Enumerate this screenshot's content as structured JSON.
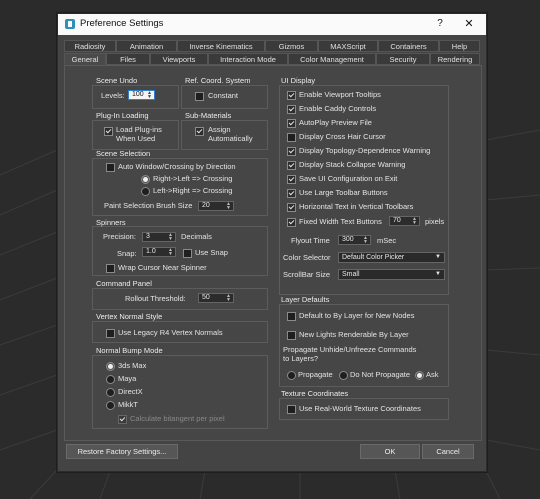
{
  "window": {
    "title": "Preference Settings",
    "help": "?",
    "close": "✕"
  },
  "tabs_row1": [
    "Radiosity",
    "Animation",
    "Inverse Kinematics",
    "Gizmos",
    "MAXScript",
    "Containers",
    "Help"
  ],
  "tabs_row2": [
    "General",
    "Files",
    "Viewports",
    "Interaction Mode",
    "Color Management",
    "Security",
    "Rendering"
  ],
  "active_tab": "General",
  "scene_undo": {
    "title": "Scene Undo",
    "levels_label": "Levels:",
    "levels_value": "100"
  },
  "ref_coord": {
    "title": "Ref. Coord. System",
    "constant_label": "Constant",
    "constant_checked": false
  },
  "plugin_loading": {
    "title": "Plug-In Loading",
    "load_label_1": "Load Plug-ins",
    "load_label_2": "When Used",
    "load_checked": true
  },
  "sub_materials": {
    "title": "Sub-Materials",
    "assign_label_1": "Assign",
    "assign_label_2": "Automatically",
    "assign_checked": true
  },
  "scene_selection": {
    "title": "Scene Selection",
    "auto_window_label": "Auto Window/Crossing by Direction",
    "auto_window_checked": false,
    "right_left_label": "Right->Left => Crossing",
    "right_left_selected": true,
    "left_right_label": "Left->Right => Crossing",
    "left_right_selected": false,
    "brush_size_label": "Paint Selection Brush Size",
    "brush_size_value": "20"
  },
  "spinners": {
    "title": "Spinners",
    "precision_label": "Precision:",
    "precision_value": "3",
    "decimals_label": "Decimals",
    "snap_label": "Snap:",
    "snap_value": "1.0",
    "use_snap_label": "Use Snap",
    "use_snap_checked": false,
    "wrap_label": "Wrap Cursor Near Spinner",
    "wrap_checked": false
  },
  "command_panel": {
    "title": "Command Panel",
    "rollout_label": "Rollout Threshold:",
    "rollout_value": "50"
  },
  "vertex_normal": {
    "title": "Vertex Normal Style",
    "legacy_label": "Use Legacy R4 Vertex Normals",
    "legacy_checked": false
  },
  "normal_bump": {
    "title": "Normal Bump Mode",
    "options": [
      "3ds Max",
      "Maya",
      "DirectX",
      "MikkT"
    ],
    "selected": "3ds Max",
    "bitangent_label": "Calculate bitangent per pixel",
    "bitangent_checked": true
  },
  "ui_display": {
    "title": "UI Display",
    "items": [
      {
        "label": "Enable Viewport Tooltips",
        "checked": true
      },
      {
        "label": "Enable Caddy Controls",
        "checked": true
      },
      {
        "label": "AutoPlay Preview File",
        "checked": true
      },
      {
        "label": "Display Cross Hair Cursor",
        "checked": false
      },
      {
        "label": "Display Topology-Dependence Warning",
        "checked": true
      },
      {
        "label": "Display Stack Collapse Warning",
        "checked": true
      },
      {
        "label": "Save UI Configuration on Exit",
        "checked": true
      },
      {
        "label": "Use Large Toolbar Buttons",
        "checked": true
      },
      {
        "label": "Horizontal Text in Vertical Toolbars",
        "checked": true
      },
      {
        "label": "Fixed Width Text Buttons",
        "checked": true
      }
    ],
    "fixed_width_value": "70",
    "pixels_label": "pixels",
    "flyout_label": "Flyout Time",
    "flyout_value": "300",
    "msec_label": "mSec",
    "color_selector_label": "Color Selector",
    "color_selector_value": "Default Color Picker",
    "scrollbar_label": "ScrollBar Size",
    "scrollbar_value": "Small"
  },
  "layer_defaults": {
    "title": "Layer Defaults",
    "default_label": "Default to By Layer for New Nodes",
    "default_checked": false,
    "new_lights_label": "New Lights Renderable By Layer",
    "new_lights_checked": false,
    "propagate_label_1": "Propagate Unhide/Unfreeze Commands",
    "propagate_label_2": "to Layers?",
    "options": [
      "Propagate",
      "Do Not Propagate",
      "Ask"
    ],
    "selected": "Ask"
  },
  "texture_coords": {
    "title": "Texture Coordinates",
    "real_world_label": "Use Real-World Texture Coordinates",
    "real_world_checked": false
  },
  "buttons": {
    "restore": "Restore Factory Settings...",
    "ok": "OK",
    "cancel": "Cancel"
  },
  "colors": {
    "dialog_bg": "#444444",
    "title_bar": "#fafafa",
    "spinner_highlight": "#2f7fd0"
  }
}
